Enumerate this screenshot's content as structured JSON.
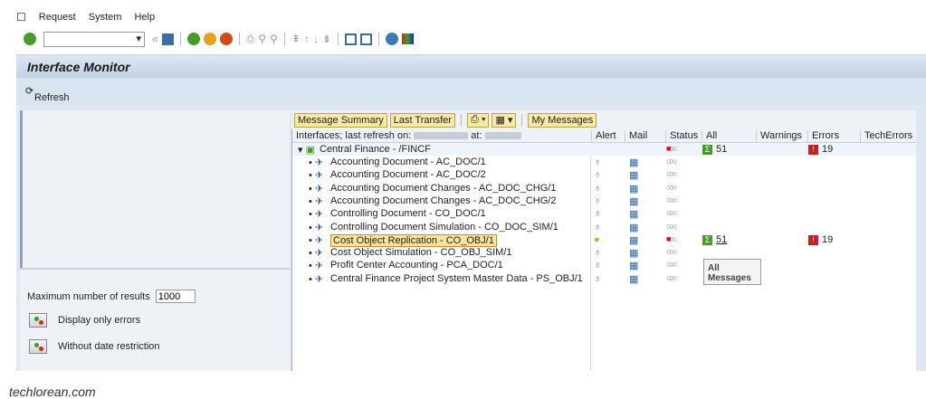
{
  "menu": [
    "Request",
    "System",
    "Help"
  ],
  "title": "Interface Monitor",
  "refresh_label": "Refresh",
  "left": {
    "max_label": "Maximum number of results",
    "max_value": "1000",
    "only_errors": "Display only errors",
    "no_date": "Without date restriction"
  },
  "right_toolbar": {
    "summary": "Message Summary",
    "last_transfer": "Last Transfer",
    "my_messages": "My Messages"
  },
  "columns": {
    "tree": "Interfaces; last refresh on:",
    "at": "at:",
    "alert": "Alert",
    "mail": "Mail",
    "status": "Status",
    "all": "All",
    "warnings": "Warnings",
    "errors": "Errors",
    "tech": "TechErrors"
  },
  "root": {
    "label": "Central Finance - /FINCF",
    "all": "51",
    "errors": "19"
  },
  "rows": [
    {
      "label": "Accounting Document - AC_DOC/1"
    },
    {
      "label": "Accounting Document - AC_DOC/2"
    },
    {
      "label": "Accounting Document Changes - AC_DOC_CHG/1"
    },
    {
      "label": "Accounting Document Changes - AC_DOC_CHG/2"
    },
    {
      "label": "Controlling Document - CO_DOC/1"
    },
    {
      "label": "Controlling Document Simulation - CO_DOC_SIM/1"
    },
    {
      "label": "Cost Object Replication - CO_OBJ/1",
      "selected": true,
      "all": "51",
      "errors": "19"
    },
    {
      "label": "Cost Object Simulation - CO_OBJ_SIM/1"
    },
    {
      "label": "Profit Center Accounting - PCA_DOC/1"
    },
    {
      "label": "Central Finance Project System Master Data - PS_OBJ/1"
    }
  ],
  "tooltip": "All Messages",
  "footer": "techlorean.com"
}
